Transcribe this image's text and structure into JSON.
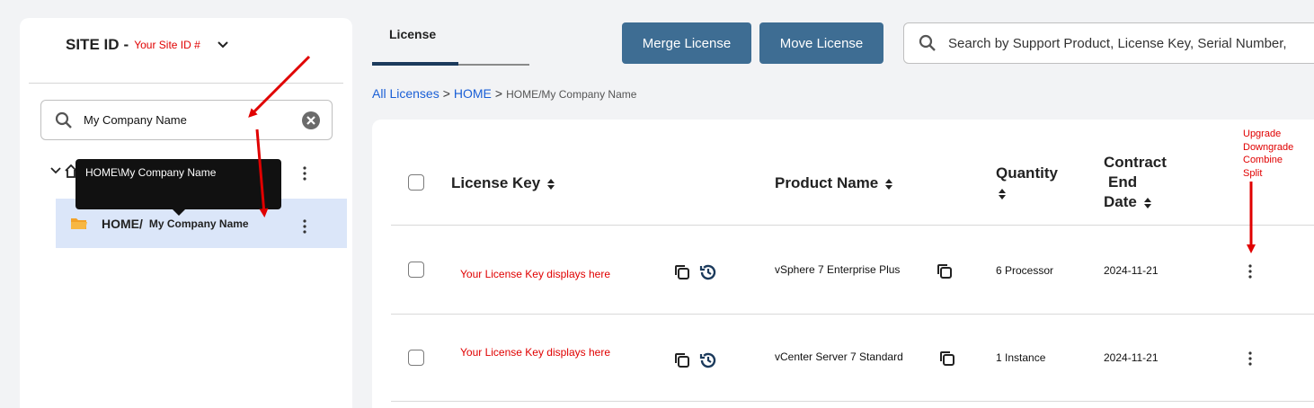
{
  "sidebar": {
    "site_id_label": "SITE ID",
    "site_id_dash": "-",
    "site_id_value": "Your Site ID #",
    "search": {
      "value": "My Company Name"
    },
    "tooltip": "HOME\\My Company Name",
    "tree": {
      "selected_home": "HOME/",
      "selected_company": "My Company Name"
    }
  },
  "header": {
    "tab": "License",
    "merge_button": "Merge License",
    "move_button": "Move License",
    "search_placeholder": "Search by Support Product, License Key, Serial Number,"
  },
  "breadcrumb": {
    "all": "All Licenses",
    "sep1": ">",
    "home": "HOME",
    "sep2": ">",
    "current": "HOME/My Company Name"
  },
  "table": {
    "columns": {
      "license_key": "License Key",
      "product_name": "Product Name",
      "quantity": "Quantity",
      "contract_line1": "Contract",
      "contract_line2": "End",
      "contract_line3": "Date"
    },
    "rows": [
      {
        "license_key": "Your License Key displays here",
        "product": "vSphere 7 Enterprise Plus",
        "quantity": "6 Processor",
        "end_date": "2024-11-21"
      },
      {
        "license_key": "Your License Key displays here",
        "product": "vCenter Server 7 Standard",
        "quantity": "1 Instance",
        "end_date": "2024-11-21"
      }
    ]
  },
  "annotation": {
    "upgrade": "Upgrade",
    "downgrade": "Downgrade",
    "combine": "Combine",
    "split": "Split"
  },
  "colors": {
    "button": "#3e6d93",
    "annotation": "#e00000",
    "link": "#1a5fd6",
    "selected_row": "#dbe6f9",
    "folder": "#f2a229"
  },
  "icons": [
    "search-icon",
    "clear-icon",
    "chevron-down-icon",
    "home-icon",
    "folder-icon",
    "kebab-icon",
    "copy-icon",
    "history-icon",
    "sort-icon"
  ]
}
